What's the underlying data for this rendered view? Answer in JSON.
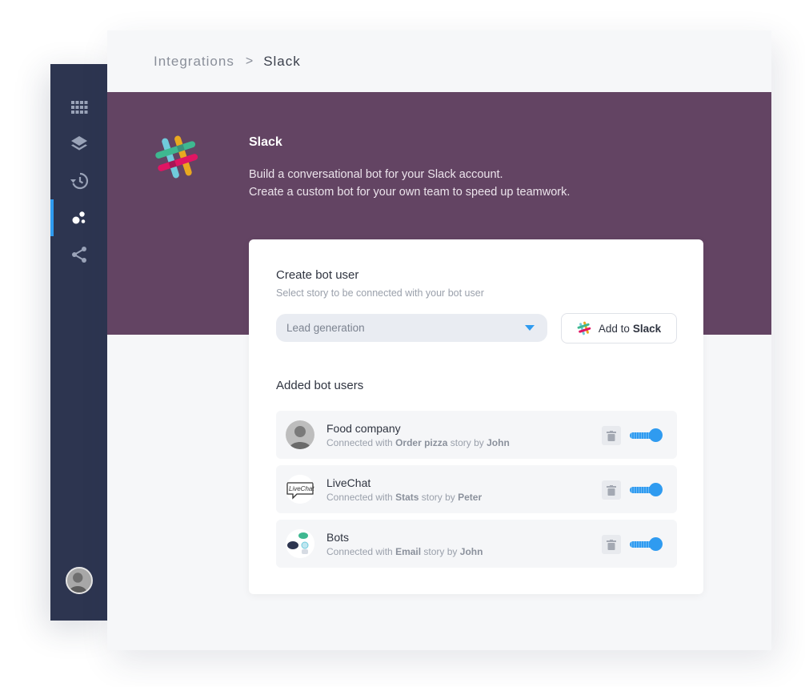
{
  "sidebar": {
    "items": [
      {
        "icon": "grid-icon"
      },
      {
        "icon": "layers-icon"
      },
      {
        "icon": "history-icon"
      },
      {
        "icon": "integrations-icon",
        "active": true
      },
      {
        "icon": "share-icon"
      }
    ],
    "accent": "#2f9bf0",
    "background": "#2d3550"
  },
  "breadcrumb": {
    "parent": "Integrations",
    "separator": ">",
    "current": "Slack"
  },
  "hero": {
    "title": "Slack",
    "description_line1": "Build a conversational bot for your Slack account.",
    "description_line2": "Create a custom bot for your own team to speed up teamwork.",
    "background": "#634463",
    "logo_icon": "slack-logo-icon"
  },
  "create_bot": {
    "heading": "Create bot user",
    "subtitle": "Select story to be connected with your bot user",
    "select_value": "Lead generation",
    "add_button_prefix": "Add to",
    "add_button_bold": "Slack"
  },
  "added": {
    "heading": "Added bot users",
    "bots": [
      {
        "name": "Food company",
        "prefix": "Connected with",
        "story": "Order pizza",
        "mid": "story by",
        "author": "John",
        "avatar": "person-avatar",
        "enabled": true
      },
      {
        "name": "LiveChat",
        "prefix": "Connected with",
        "story": "Stats",
        "mid": "story by",
        "author": "Peter",
        "avatar": "livechat-logo",
        "avatar_text": "LiveChat",
        "enabled": true
      },
      {
        "name": "Bots",
        "prefix": "Connected with",
        "story": "Email",
        "mid": "story by",
        "author": "John",
        "avatar": "bots-logo",
        "enabled": true
      }
    ]
  }
}
